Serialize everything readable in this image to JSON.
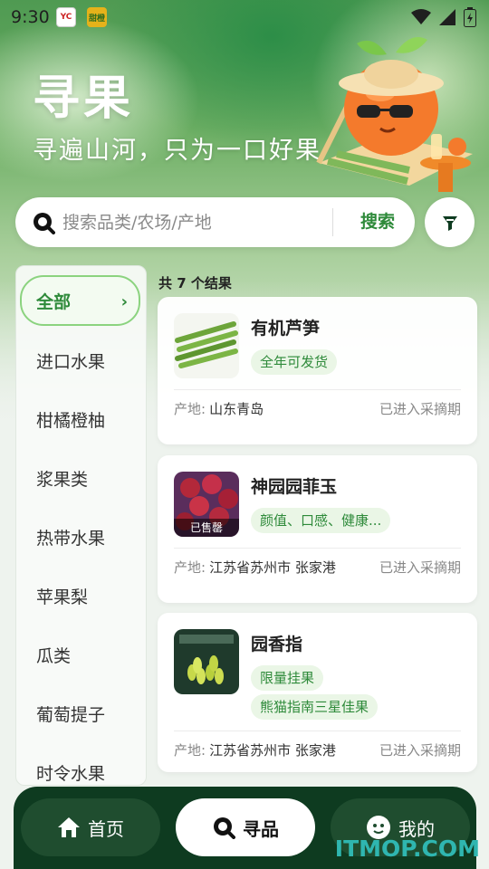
{
  "status_bar": {
    "time": "9:30",
    "badge1": "YC",
    "badge2": "甜橙"
  },
  "hero": {
    "title": "寻果",
    "subtitle": "寻遍山河，只为一口好果"
  },
  "search": {
    "placeholder": "搜索品类/农场/产地",
    "button_label": "搜索"
  },
  "categories": [
    {
      "label": "全部",
      "active": true
    },
    {
      "label": "进口水果"
    },
    {
      "label": "柑橘橙柚"
    },
    {
      "label": "浆果类"
    },
    {
      "label": "热带水果"
    },
    {
      "label": "苹果梨"
    },
    {
      "label": "瓜类"
    },
    {
      "label": "葡萄提子"
    },
    {
      "label": "时令水果"
    }
  ],
  "results": {
    "count_label": "共 7 个结果",
    "origin_label": "产地:",
    "items": [
      {
        "name": "有机芦笋",
        "tags": [
          "全年可发货"
        ],
        "origin": "山东青岛",
        "status": "已进入采摘期"
      },
      {
        "name": "神园园菲玉",
        "tags": [
          "颜值、口感、健康..."
        ],
        "origin": "江苏省苏州市 张家港",
        "status": "已进入采摘期",
        "sold_out": "已售罄"
      },
      {
        "name": "园香指",
        "tags": [
          "限量挂果",
          "熊猫指南三星佳果"
        ],
        "origin": "江苏省苏州市 张家港",
        "status": "已进入采摘期"
      }
    ]
  },
  "bottom_nav": {
    "home": "首页",
    "find": "寻品",
    "mine": "我的"
  },
  "watermark": "ITMOP.COM",
  "colors": {
    "accent": "#2e8a3a",
    "nav_bg": "#0e3b20",
    "tag_bg": "#eaf6e6"
  }
}
